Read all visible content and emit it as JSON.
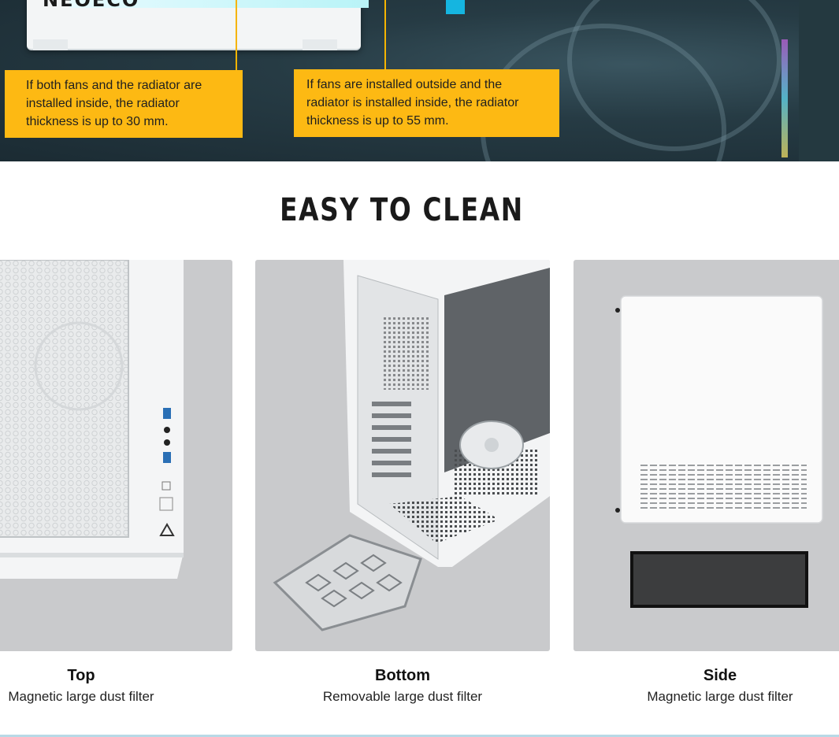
{
  "hero": {
    "brand_text": "NEOECO",
    "callout_inside": [
      "If both fans and the radiator are",
      "installed inside, the radiator",
      "thickness is up to 30 mm."
    ],
    "callout_outside": [
      "If fans are installed outside and the",
      "radiator is installed inside, the radiator",
      "thickness is up to 55 mm."
    ],
    "accent_color": "#fdb913"
  },
  "section": {
    "title": "EASY TO CLEAN"
  },
  "filters": [
    {
      "title": "Top",
      "subtitle": "Magnetic large dust filter"
    },
    {
      "title": "Bottom",
      "subtitle": "Removable large dust filter"
    },
    {
      "title": "Side",
      "subtitle": "Magnetic large dust filter"
    }
  ]
}
